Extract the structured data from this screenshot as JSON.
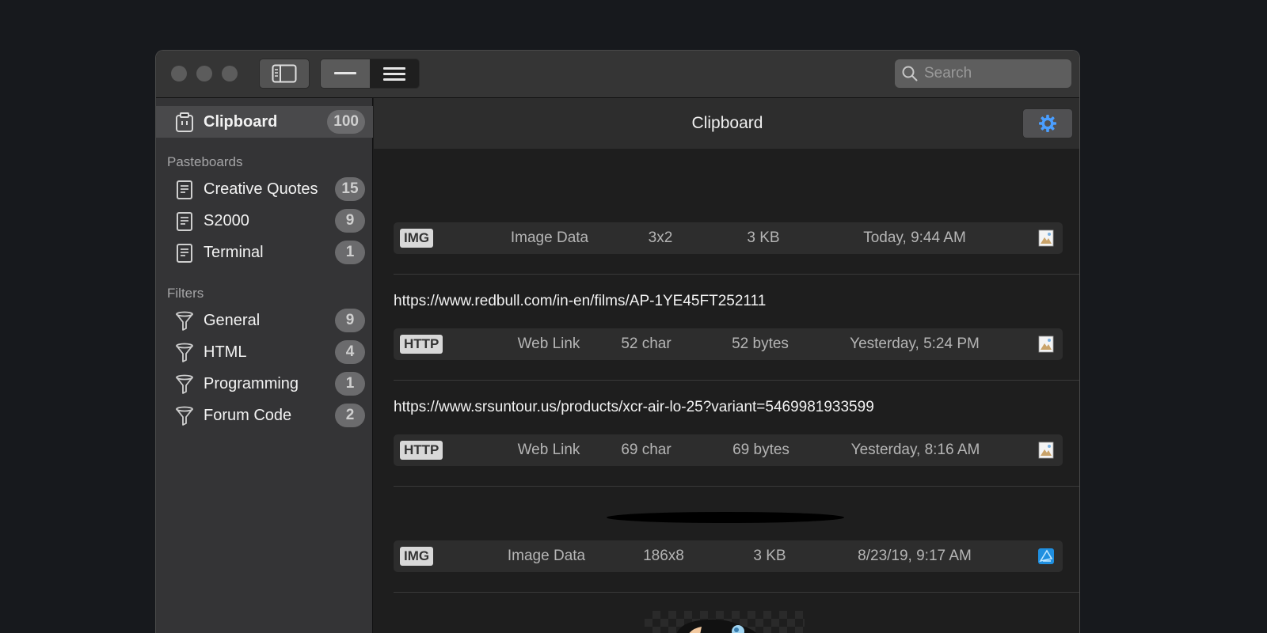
{
  "search": {
    "placeholder": "Search"
  },
  "sidebar": {
    "clipboard": {
      "label": "Clipboard",
      "count": "100"
    },
    "pasteboards_heading": "Pasteboards",
    "pasteboards": [
      {
        "label": "Creative Quotes",
        "count": "15"
      },
      {
        "label": "S2000",
        "count": "9"
      },
      {
        "label": "Terminal",
        "count": "1"
      }
    ],
    "filters_heading": "Filters",
    "filters": [
      {
        "label": "General",
        "count": "9"
      },
      {
        "label": "HTML",
        "count": "4"
      },
      {
        "label": "Programming",
        "count": "1"
      },
      {
        "label": "Forum Code",
        "count": "2"
      }
    ]
  },
  "main": {
    "title": "Clipboard",
    "items": [
      {
        "text": "",
        "tag": "IMG",
        "kind": "Image Data",
        "size": "3x2",
        "bytes": "3 KB",
        "time": "Today, 9:44 AM",
        "app_icon": "preview-icon"
      },
      {
        "text": "https://www.redbull.com/in-en/films/AP-1YE45FT252111",
        "tag": "HTTP",
        "kind": "Web Link",
        "size": "52 char",
        "bytes": "52 bytes",
        "time": "Yesterday, 5:24 PM",
        "app_icon": "preview-icon"
      },
      {
        "text": "https://www.srsuntour.us/products/xcr-air-lo-25?variant=5469981933599",
        "tag": "HTTP",
        "kind": "Web Link",
        "size": "69 char",
        "bytes": "69 bytes",
        "time": "Yesterday, 8:16 AM",
        "app_icon": "preview-icon"
      },
      {
        "text": "",
        "tag": "IMG",
        "kind": "Image Data",
        "size": "186x8",
        "bytes": "3 KB",
        "time": "8/23/19, 9:17 AM",
        "app_icon": "affinity-icon"
      }
    ]
  },
  "colors": {
    "accent": "#4a9eff",
    "badge": "#6b6b6d",
    "selected": "#49494b"
  }
}
